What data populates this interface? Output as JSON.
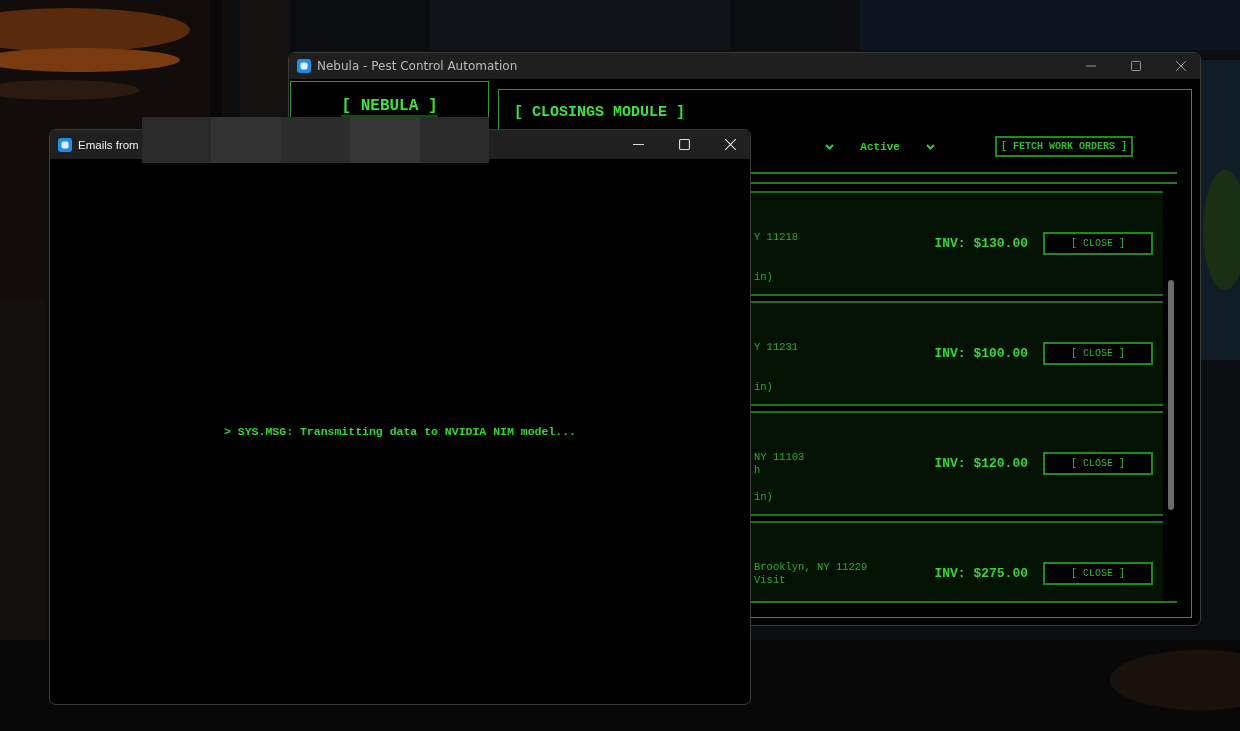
{
  "nebula_window": {
    "title": "Nebula - Pest Control Automation",
    "sidebar": {
      "brand": "[ NEBULA ]"
    },
    "module": {
      "title": "[ CLOSINGS MODULE ]",
      "filters": [
        {
          "kind": "dropdown"
        },
        {
          "kind": "dropdown",
          "value": "Active"
        }
      ],
      "fetch_button": "[ FETCH WORK ORDERS ]",
      "work_orders": [
        {
          "address": "Y 11218",
          "duration": "in)",
          "invoice": "INV: $130.00",
          "action": "[ CLOSE ]"
        },
        {
          "address": "Y 11231",
          "duration": "in)",
          "invoice": "INV: $100.00",
          "action": "[ CLOSE ]"
        },
        {
          "address": "NY 11103",
          "service": "h",
          "duration": "in)",
          "invoice": "INV: $120.00",
          "action": "[ CLOSE ]"
        },
        {
          "address": "Brooklyn, NY 11229",
          "service": "Visit",
          "invoice": "INV: $275.00",
          "action": "[ CLOSE ]"
        }
      ]
    }
  },
  "emails_window": {
    "title": "Emails from",
    "title_redacted": true,
    "message": "> SYS.MSG: Transmitting data to NVIDIA NIM model..."
  }
}
